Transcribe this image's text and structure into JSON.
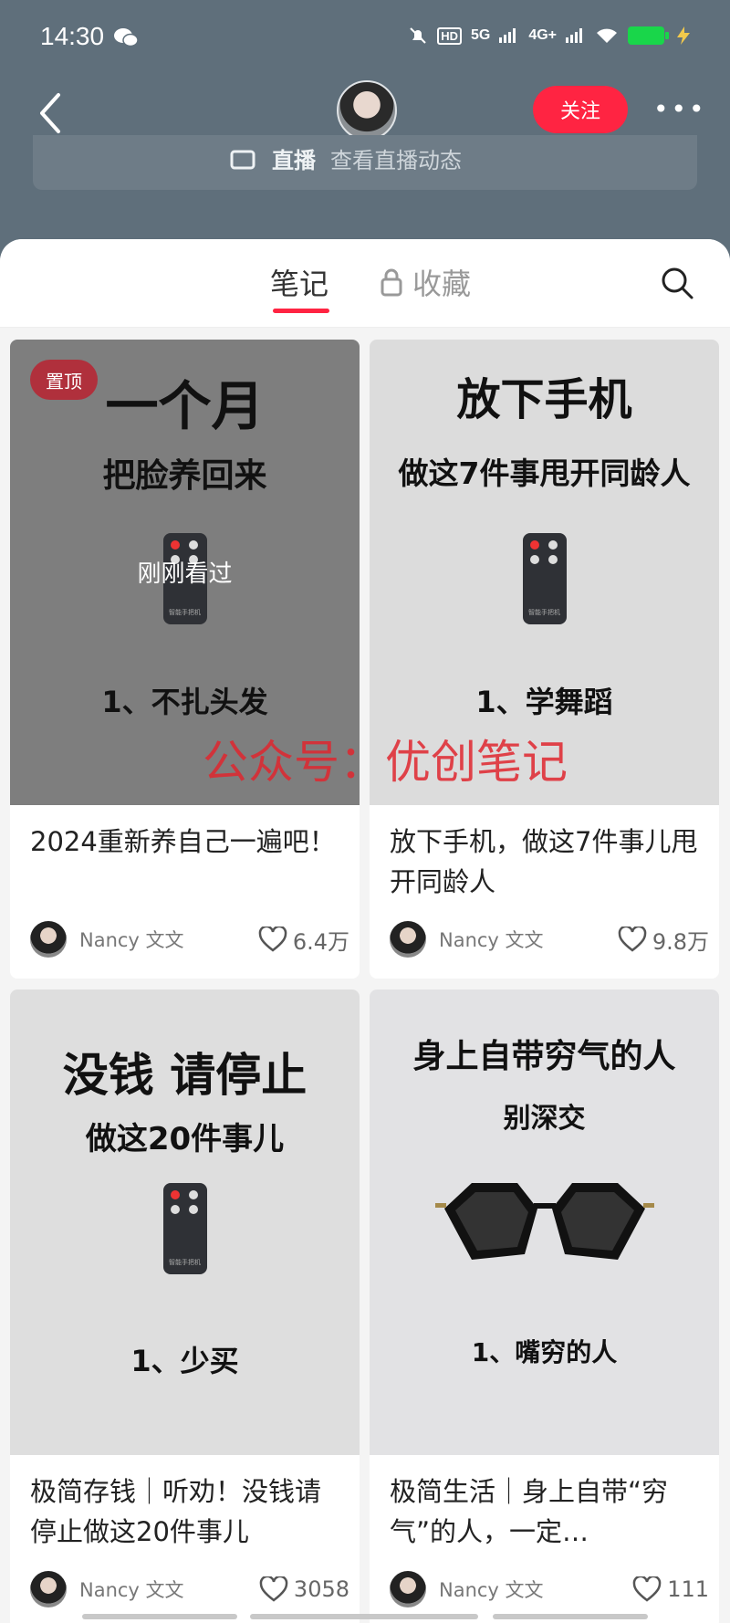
{
  "status": {
    "time": "14:30",
    "network": [
      "HD",
      "5G",
      "4G+"
    ],
    "battery_color": "#19d64a"
  },
  "header": {
    "follow_label": "关注",
    "more_label": "•••"
  },
  "live": {
    "label": "直播",
    "sub": "查看直播动态"
  },
  "tabs": {
    "notes": "笔记",
    "favorites": "收藏"
  },
  "watermark": "公众号：优创笔记",
  "cards": [
    {
      "pinned_label": "置顶",
      "seen_label": "刚刚看过",
      "thumb": {
        "headline": "一个月",
        "sub": "把脸养回来",
        "point": "1、不扎头发",
        "remote_label": "智能手把机"
      },
      "title": "2024重新养自己一遍吧！",
      "author": "Nancy 文文",
      "likes": "6.4万"
    },
    {
      "thumb": {
        "headline": "放下手机",
        "sub": "做这7件事甩开同龄人",
        "point": "1、学舞蹈",
        "remote_label": "智能手把机"
      },
      "title": "放下手机，做这7件事儿甩开同龄人",
      "author": "Nancy 文文",
      "likes": "9.8万"
    },
    {
      "thumb": {
        "headline": "没钱 请停止",
        "sub": "做这20件事儿",
        "point": "1、少买",
        "remote_label": "智能手把机"
      },
      "title": "极简存钱｜听劝！没钱请停止做这20件事儿",
      "author": "Nancy 文文",
      "likes": "3058"
    },
    {
      "thumb": {
        "headline": "身上自带穷气的人",
        "sub": "别深交",
        "point": "1、嘴穷的人"
      },
      "title": "极简生活｜身上自带“穷气”的人，一定…",
      "author": "Nancy 文文",
      "likes": "111"
    }
  ]
}
